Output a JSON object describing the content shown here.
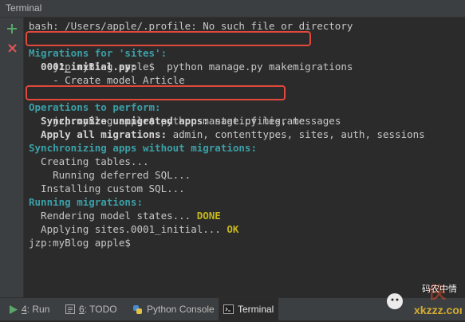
{
  "window": {
    "title": "Terminal"
  },
  "gutter": {
    "add_icon": "plus-icon",
    "close_icon": "close-icon"
  },
  "terminal": {
    "lines": {
      "l0": "bash: /Users/apple/.profile: No such file or directory",
      "l1": "jzp:myBlog apple$  python manage.py makemigrations",
      "l2": "Migrations for 'sites':",
      "l3": "  0001_initial.py:",
      "l4": "    - Create model Article",
      "l5": "jzp:myBlog apple$ python manage.py migrate",
      "l6": "Operations to perform:",
      "l7a": "  Synchronize unmigrated apps:",
      "l7b": " staticfiles, messages",
      "l8a": "  Apply all migrations:",
      "l8b": " admin, contenttypes, sites, auth, sessions",
      "l9": "Synchronizing apps without migrations:",
      "l10": "  Creating tables...",
      "l11": "    Running deferred SQL...",
      "l12": "  Installing custom SQL...",
      "l13": "Running migrations:",
      "l14a": "  Rendering model states... ",
      "l14b": "DONE",
      "l15a": "  Applying sites.0001_initial... ",
      "l15b": "OK",
      "l16": "jzp:myBlog apple$"
    },
    "colors": {
      "accent_cyan": "#3ba0a8",
      "status_yellow": "#c6b818",
      "highlight_box": "#e0493b"
    }
  },
  "tool_windows": {
    "run": {
      "number": "4",
      "label": ": Run",
      "icon": "run-icon"
    },
    "todo": {
      "number": "6",
      "label": ": TODO",
      "icon": "todo-icon"
    },
    "python_console": {
      "label": "Python Console",
      "icon": "python-icon"
    },
    "terminal": {
      "label": "Terminal",
      "icon": "terminal-icon"
    }
  },
  "watermark": {
    "text": "码农中情",
    "logo": "wechat-logo"
  }
}
